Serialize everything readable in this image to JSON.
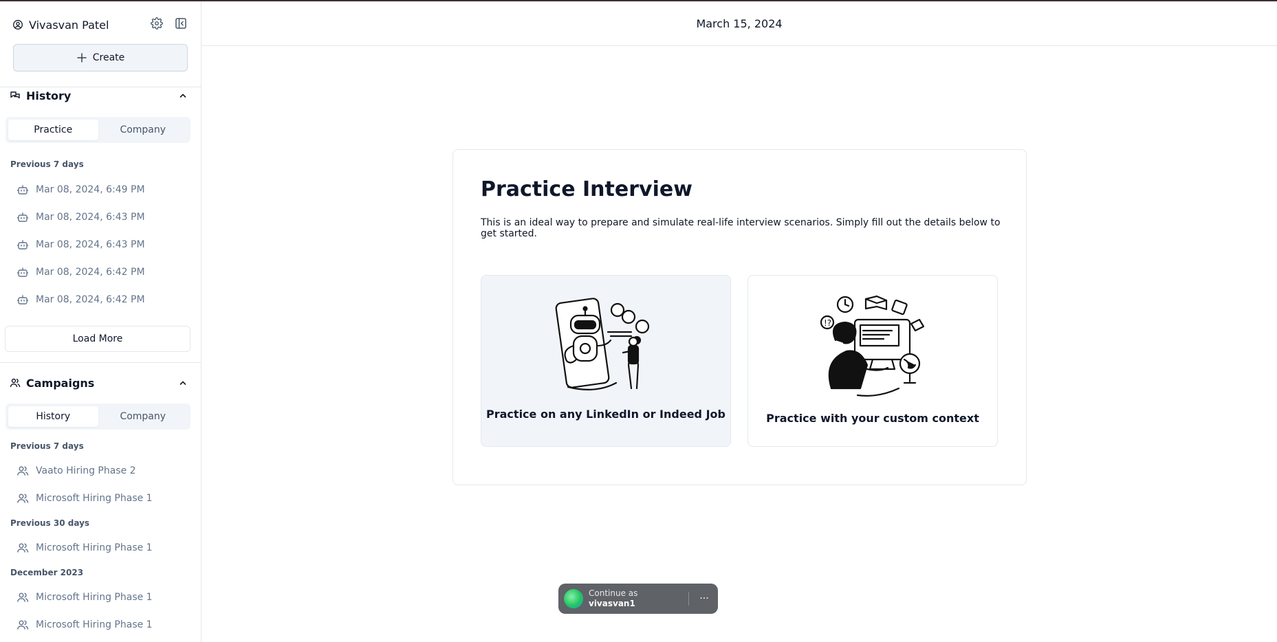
{
  "user": {
    "name": "Vivasvan Patel"
  },
  "sidebar": {
    "create_label": "Create",
    "history": {
      "title": "History",
      "tabs": [
        "Practice",
        "Company"
      ],
      "active_tab": "Practice",
      "group_label": "Previous 7 days",
      "items": [
        "Mar 08, 2024, 6:49 PM",
        "Mar 08, 2024, 6:43 PM",
        "Mar 08, 2024, 6:43 PM",
        "Mar 08, 2024, 6:42 PM",
        "Mar 08, 2024, 6:42 PM"
      ],
      "load_more": "Load More"
    },
    "campaigns": {
      "title": "Campaigns",
      "tabs": [
        "History",
        "Company"
      ],
      "active_tab": "History",
      "groups": [
        {
          "label": "Previous 7 days",
          "items": [
            "Vaato Hiring Phase 2",
            "Microsoft Hiring Phase 1"
          ]
        },
        {
          "label": "Previous 30 days",
          "items": [
            "Microsoft Hiring Phase 1"
          ]
        },
        {
          "label": "December 2023",
          "items": [
            "Microsoft Hiring Phase 1",
            "Microsoft Hiring Phase 1"
          ]
        }
      ]
    }
  },
  "header": {
    "date": "March 15, 2024"
  },
  "main": {
    "title": "Practice Interview",
    "description": "This is an ideal way to prepare and simulate real-life interview scenarios. Simply fill out the details below to get started.",
    "options": [
      {
        "label": "Practice on any LinkedIn or Indeed Job",
        "selected": true,
        "icon": "robot-interview-illustration"
      },
      {
        "label": "Practice with your custom context",
        "selected": false,
        "icon": "person-at-computer-illustration"
      }
    ]
  },
  "google_prompt": {
    "continue_as": "Continue as",
    "username": "vivasvan1",
    "more": "···"
  },
  "colors": {
    "accent_bg": "#f1f5f9",
    "border": "#e2e8f0",
    "muted_text": "#64748b",
    "pill_bg": "#5f6368"
  }
}
